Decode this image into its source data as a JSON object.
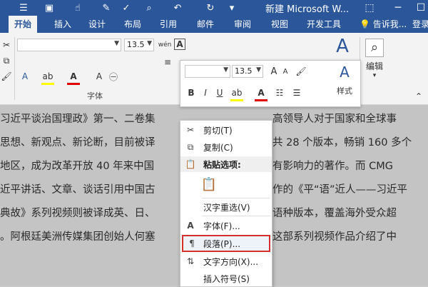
{
  "app": {
    "title": "新建 Microsoft W..."
  },
  "tabs": [
    {
      "label": "开始",
      "active": true
    },
    {
      "label": "插入"
    },
    {
      "label": "设计"
    },
    {
      "label": "布局"
    },
    {
      "label": "引用"
    },
    {
      "label": "邮件"
    },
    {
      "label": "审阅"
    },
    {
      "label": "视图"
    },
    {
      "label": "开发工具"
    }
  ],
  "tell_me": "告诉我...",
  "login": "登录",
  "ribbon": {
    "font_size": "13.5",
    "wen_glyph": "wén",
    "font_group_label": "字体",
    "style_label": "样式",
    "edit_label": "编辑"
  },
  "mini_toolbar": {
    "font_size": "13.5",
    "style_label": "样式"
  },
  "document": {
    "lines": [
      "习近平谈治国理政》第一、二卷集",
      "思想、新观点、新论断，目前被译",
      "地区，成为改革开放 40 年来中国",
      "近平讲话、文章、谈话引用中国古",
      "典故》系列视频则被译成英、日、",
      "。阿根廷美洲传媒集团创始人何塞"
    ],
    "right_lines": [
      "高领导人对于国家和全球事",
      "共 28 个版本，畅销 160 多个",
      "有影响力的著作。而 CMG ",
      "作的《平“语”近人——习近平",
      "语种版本，覆盖海外受众超",
      "这部系列视频作品介绍了中"
    ]
  },
  "context_menu": {
    "cut": "剪切(T)",
    "copy": "复制(C)",
    "paste_options": "粘贴选项:",
    "reconvert": "汉字重选(V)",
    "font": "字体(F)...",
    "paragraph": "段落(P)...",
    "text_direction": "文字方向(X)...",
    "insert_symbol": "插入符号(S)"
  },
  "colors": {
    "accent": "#2b579a",
    "highlight_box": "#d32f2f"
  }
}
